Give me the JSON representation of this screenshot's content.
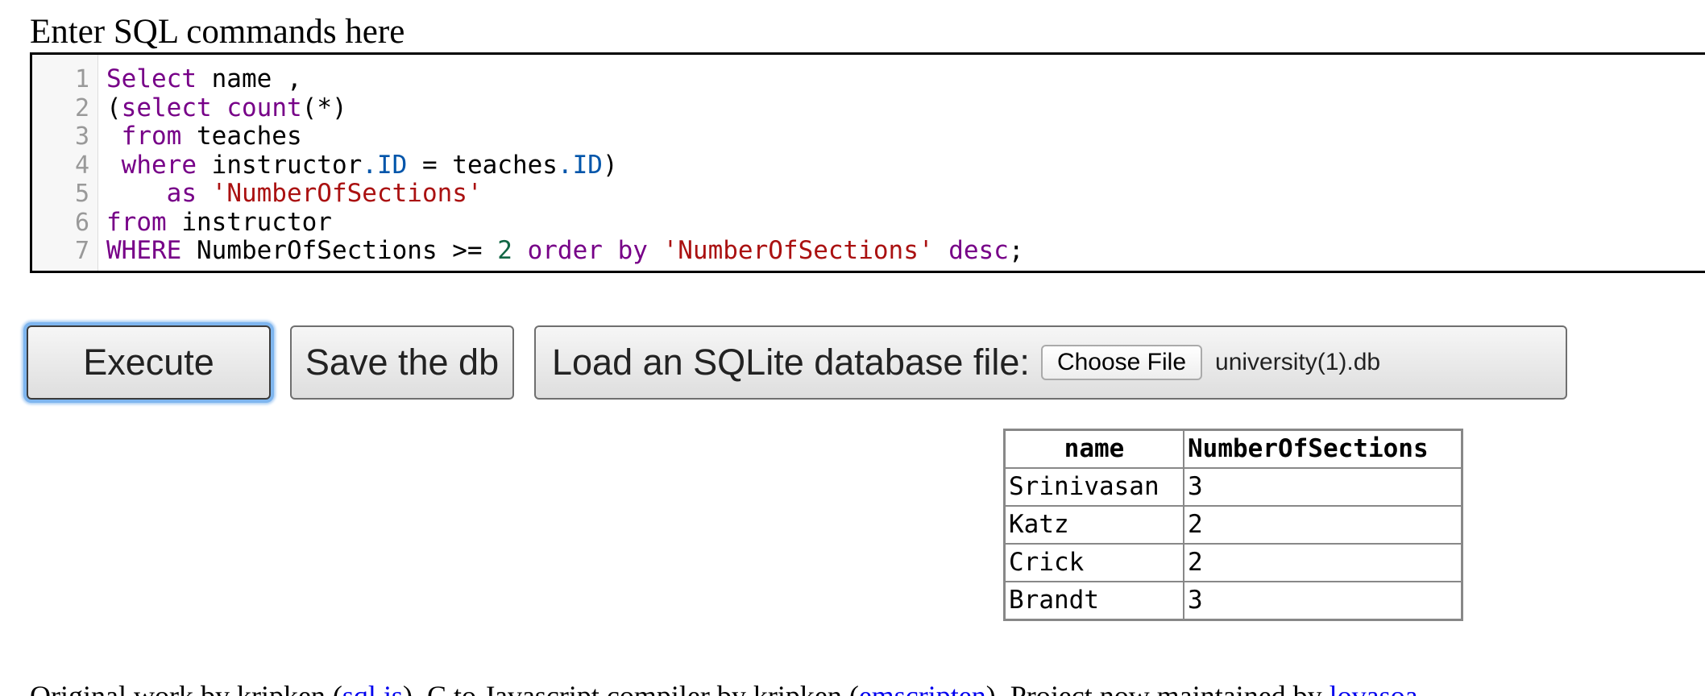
{
  "heading": "Enter SQL commands here",
  "editor": {
    "line_numbers": [
      "1",
      "2",
      "3",
      "4",
      "5",
      "6",
      "7"
    ],
    "lines": [
      [
        {
          "t": "kw",
          "v": "Select"
        },
        {
          "t": "plain",
          "v": " name ,"
        }
      ],
      [
        {
          "t": "plain",
          "v": "("
        },
        {
          "t": "kw",
          "v": "select"
        },
        {
          "t": "plain",
          "v": " "
        },
        {
          "t": "fn",
          "v": "count"
        },
        {
          "t": "plain",
          "v": "(*)"
        }
      ],
      [
        {
          "t": "plain",
          "v": " "
        },
        {
          "t": "kw",
          "v": "from"
        },
        {
          "t": "plain",
          "v": " teaches"
        }
      ],
      [
        {
          "t": "plain",
          "v": " "
        },
        {
          "t": "kw",
          "v": "where"
        },
        {
          "t": "plain",
          "v": " instructor"
        },
        {
          "t": "prop",
          "v": ".ID"
        },
        {
          "t": "plain",
          "v": " = teaches"
        },
        {
          "t": "prop",
          "v": ".ID"
        },
        {
          "t": "plain",
          "v": ")"
        }
      ],
      [
        {
          "t": "plain",
          "v": "    "
        },
        {
          "t": "kw",
          "v": "as"
        },
        {
          "t": "plain",
          "v": " "
        },
        {
          "t": "str",
          "v": "'NumberOfSections'"
        }
      ],
      [
        {
          "t": "kw",
          "v": "from"
        },
        {
          "t": "plain",
          "v": " instructor"
        }
      ],
      [
        {
          "t": "kw",
          "v": "WHERE"
        },
        {
          "t": "plain",
          "v": " NumberOfSections >= "
        },
        {
          "t": "num",
          "v": "2"
        },
        {
          "t": "plain",
          "v": " "
        },
        {
          "t": "kw",
          "v": "order by"
        },
        {
          "t": "plain",
          "v": " "
        },
        {
          "t": "str",
          "v": "'NumberOfSections'"
        },
        {
          "t": "plain",
          "v": " "
        },
        {
          "t": "kw",
          "v": "desc"
        },
        {
          "t": "plain",
          "v": ";"
        }
      ]
    ]
  },
  "toolbar": {
    "execute_label": "Execute",
    "save_label": "Save the db",
    "load_label": "Load an SQLite database file:",
    "choose_file_label": "Choose File",
    "file_name": "university(1).db"
  },
  "results": {
    "columns": [
      "name",
      "NumberOfSections"
    ],
    "rows": [
      [
        "Srinivasan",
        "3"
      ],
      [
        "Katz",
        "2"
      ],
      [
        "Crick",
        "2"
      ],
      [
        "Brandt",
        "3"
      ]
    ]
  },
  "footer": {
    "parts": [
      {
        "type": "text",
        "v": "Original work by kripken ("
      },
      {
        "type": "link",
        "v": "sql.js"
      },
      {
        "type": "text",
        "v": "). C to Javascript compiler by kripken ("
      },
      {
        "type": "link",
        "v": "emscripten"
      },
      {
        "type": "text",
        "v": "). Project now maintained by "
      },
      {
        "type": "link",
        "v": "lovasoa"
      }
    ]
  },
  "colors": {
    "keyword": "#770088",
    "string": "#aa1111",
    "number": "#116644",
    "property": "#0055aa",
    "focus_ring": "#7fb6ef",
    "link": "#0000ee"
  }
}
